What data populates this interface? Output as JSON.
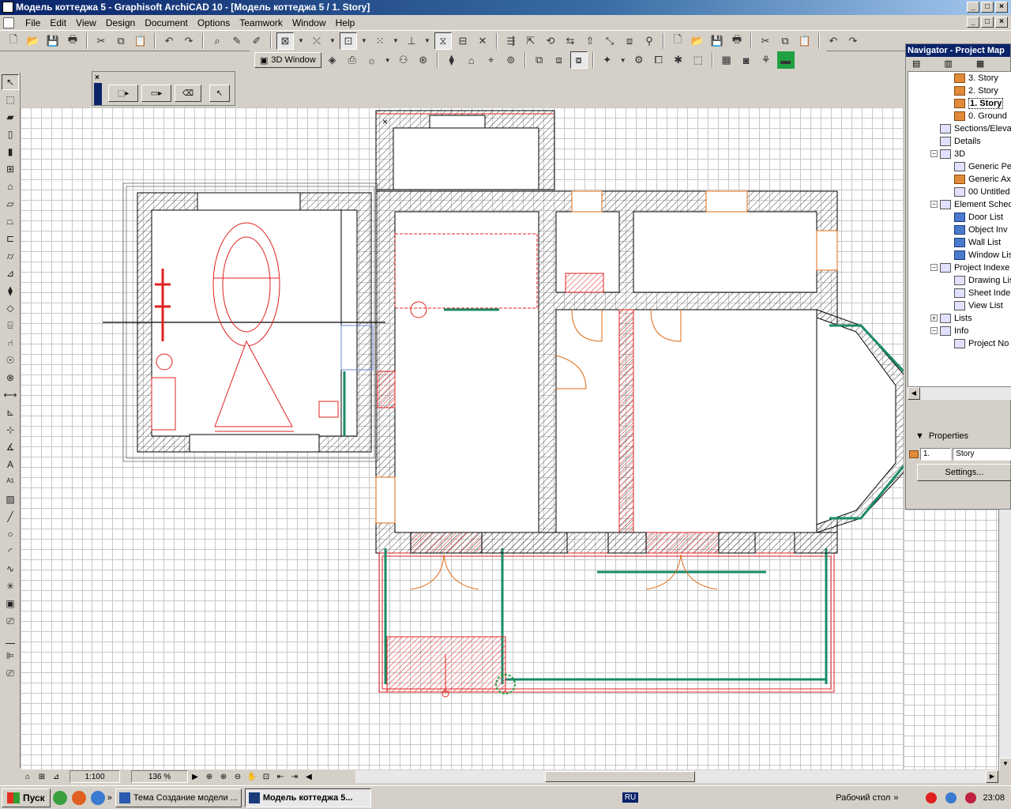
{
  "window": {
    "title": "Модель коттеджа 5 - Graphisoft ArchiCAD 10 - [Модель коттеджа 5 / 1. Story]",
    "btn_min": "_",
    "btn_max": "□",
    "btn_close": "×"
  },
  "menu": [
    "File",
    "Edit",
    "View",
    "Design",
    "Document",
    "Options",
    "Teamwork",
    "Window",
    "Help"
  ],
  "toolbar2": {
    "btn_3d_window": "3D Window"
  },
  "navigator": {
    "title": "Navigator - Project Map",
    "tree": [
      {
        "label": "3. Story",
        "icon": "orange"
      },
      {
        "label": "2. Story",
        "icon": "orange"
      },
      {
        "label": "1. Story",
        "icon": "orange",
        "selected": true
      },
      {
        "label": "0. Ground",
        "icon": "orange"
      },
      {
        "label": "Sections/Eleva",
        "icon": "plain"
      },
      {
        "label": "Details",
        "icon": "plain"
      },
      {
        "label": "3D",
        "icon": "plain"
      },
      {
        "label": "Generic Pe",
        "icon": "plain"
      },
      {
        "label": "Generic Ax",
        "icon": "orange"
      },
      {
        "label": "00 Untitled",
        "icon": "plain"
      },
      {
        "label": "Element Sched",
        "icon": "plain"
      },
      {
        "label": "Door List",
        "icon": "blue"
      },
      {
        "label": "Object Inv",
        "icon": "blue"
      },
      {
        "label": "Wall List",
        "icon": "blue"
      },
      {
        "label": "Window Lis",
        "icon": "blue"
      },
      {
        "label": "Project Indexe",
        "icon": "plain"
      },
      {
        "label": "Drawing Lis",
        "icon": "plain"
      },
      {
        "label": "Sheet Inde",
        "icon": "plain"
      },
      {
        "label": "View List",
        "icon": "plain"
      },
      {
        "label": "Lists",
        "icon": "plain"
      },
      {
        "label": "Info",
        "icon": "plain"
      },
      {
        "label": "Project No",
        "icon": "plain"
      }
    ],
    "properties_label": "Properties",
    "prop_number": "1.",
    "prop_name": "Story",
    "settings_label": "Settings..."
  },
  "status": {
    "scale": "1:100",
    "zoom": "136 %"
  },
  "taskbar": {
    "start_label": "Пуск",
    "task1": "Тема Создание модели ...",
    "task2": "Модель коттеджа 5...",
    "lang": "RU",
    "desktop": "Рабочий стол",
    "chevron": "»",
    "time": "23:08"
  },
  "colors": {
    "titlebar": "#0a246a",
    "wall_hatch": "#000000",
    "red_lines": "#e02020",
    "orange_doors": "#e06a10",
    "green_windows": "#1a8a6a"
  }
}
